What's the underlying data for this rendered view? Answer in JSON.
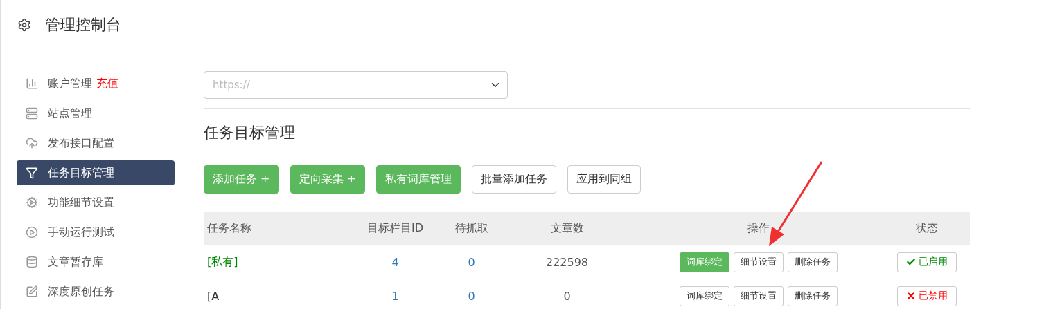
{
  "header": {
    "title": "管理控制台"
  },
  "sidebar": {
    "items": [
      {
        "kind": "chart",
        "label": "账户管理",
        "badge": "充值",
        "selected": false
      },
      {
        "kind": "server",
        "label": "站点管理",
        "selected": false
      },
      {
        "kind": "cloud",
        "label": "发布接口配置",
        "selected": false
      },
      {
        "kind": "filter",
        "label": "任务目标管理",
        "selected": true
      },
      {
        "kind": "gears",
        "label": "功能细节设置",
        "selected": false
      },
      {
        "kind": "play",
        "label": "手动运行测试",
        "selected": false
      },
      {
        "kind": "database",
        "label": "文章暂存库",
        "selected": false
      },
      {
        "kind": "edit",
        "label": "深度原创任务",
        "selected": false
      }
    ]
  },
  "site_select": {
    "value": "https://"
  },
  "page_title": "任务目标管理",
  "toolbar": [
    {
      "label": "添加任务 +",
      "primary": true
    },
    {
      "label": "定向采集 +",
      "primary": true
    },
    {
      "label": "私有词库管理",
      "primary": true
    },
    {
      "label": "批量添加任务",
      "primary": false
    },
    {
      "label": "应用到同组",
      "primary": false
    }
  ],
  "table": {
    "columns": [
      "任务名称",
      "目标栏目ID",
      "待抓取",
      "文章数",
      "操作",
      "状态"
    ],
    "rows": [
      {
        "name": "[私有]",
        "linked": true,
        "target_id": "4",
        "pending": "0",
        "articles": "222598",
        "actions": [
          {
            "label": "词库绑定",
            "primary": true
          },
          {
            "label": "细节设置",
            "primary": false
          },
          {
            "label": "删除任务",
            "primary": false
          }
        ],
        "status": {
          "label": "已启用",
          "on": true
        }
      },
      {
        "name": "[A",
        "linked": false,
        "target_id": "1",
        "pending": "0",
        "articles": "0",
        "actions": [
          {
            "label": "词库绑定",
            "primary": false
          },
          {
            "label": "细节设置",
            "primary": false
          },
          {
            "label": "删除任务",
            "primary": false
          }
        ],
        "status": {
          "label": "已禁用",
          "on": false
        }
      }
    ]
  }
}
